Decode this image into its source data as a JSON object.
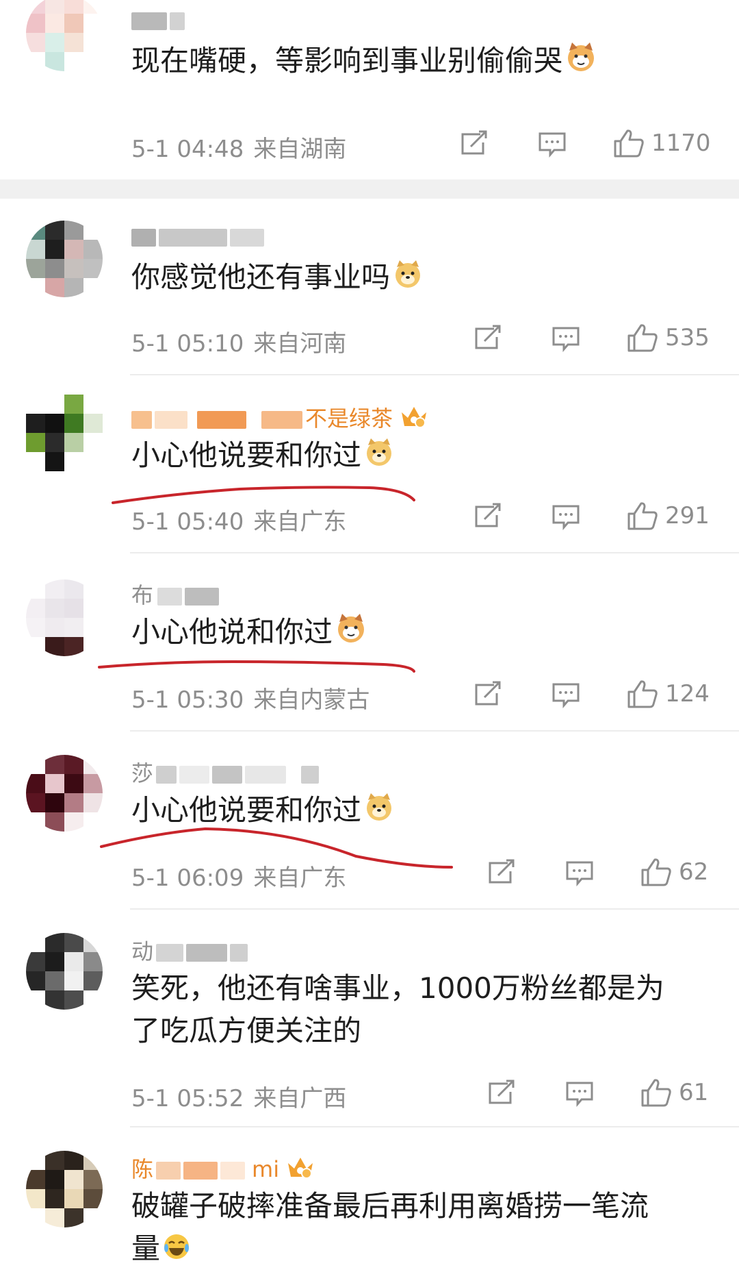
{
  "comments": [
    {
      "name_visible": "",
      "text": "现在嘴硬，等影响到事业别偷偷哭",
      "time": "5-1 04:48",
      "location": "来自湖南",
      "likes": "1170"
    },
    {
      "name_visible": "",
      "text": "你感觉他还有事业吗",
      "time": "5-1 05:10",
      "location": "来自河南",
      "likes": "535"
    },
    {
      "name_visible": "不是绿茶",
      "text": "小心他说要和你过",
      "time": "5-1 05:40",
      "location": "来自广东",
      "likes": "291"
    },
    {
      "name_visible": "布",
      "text": "小心他说和你过",
      "time": "5-1 05:30",
      "location": "来自内蒙古",
      "likes": "124"
    },
    {
      "name_visible": "莎",
      "text": "小心他说要和你过",
      "time": "5-1 06:09",
      "location": "来自广东",
      "likes": "62"
    },
    {
      "name_visible": "动",
      "text_line1": "笑死，他还有啥事业，1000万粉丝都是为",
      "text_line2": "了吃瓜方便关注的",
      "time": "5-1 05:52",
      "location": "来自广西",
      "likes": "61"
    },
    {
      "name_visible": "陈",
      "name_suffix": "mi",
      "text_line1": "破罐子破摔准备最后再利用离婚捞一笔流",
      "text_line2": "量"
    }
  ],
  "colors": {
    "meta_gray": "#8d8d8d",
    "vip_name_orange": "#e9882b",
    "red_underline": "#c8252b"
  },
  "icons": [
    "share-icon",
    "comment-icon",
    "like-icon",
    "crown-vip-icon",
    "cat-emoji",
    "doge-emoji",
    "laugh-cry-emoji"
  ]
}
